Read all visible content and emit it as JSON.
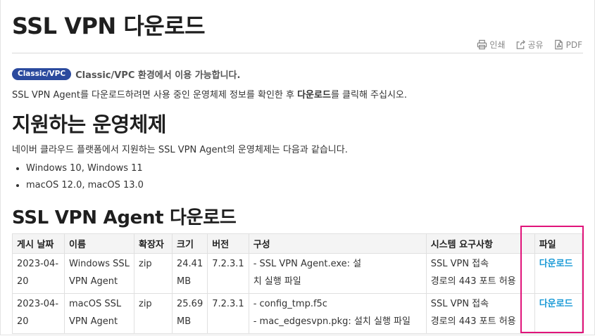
{
  "header": {
    "title": "SSL VPN 다운로드",
    "tools": {
      "print": "인쇄",
      "share": "공유",
      "pdf": "PDF"
    }
  },
  "env": {
    "badge": "Classic/VPC",
    "text": "Classic/VPC 환경에서 이용 가능합니다."
  },
  "intro": {
    "before": "SSL VPN Agent를 다운로드하려면 사용 중인 운영체제 정보를 확인한 후 ",
    "bold": "다운로드",
    "after": "를 클릭해 주십시오."
  },
  "os_section": {
    "heading": "지원하는 운영체제",
    "desc": "네이버 클라우드 플랫폼에서 지원하는 SSL VPN Agent의 운영체제는 다음과 같습니다.",
    "items": [
      "Windows 10, Windows 11",
      "macOS 12.0, macOS 13.0"
    ]
  },
  "download_section": {
    "heading": "SSL VPN Agent 다운로드",
    "columns": [
      "게시 날짜",
      "이름",
      "확장자",
      "크기",
      "버전",
      "구성",
      "시스템 요구사항",
      "파일"
    ],
    "rows": [
      {
        "date_a": "2023-04-",
        "date_b": "20",
        "name_a": "Windows SSL",
        "name_b": "VPN Agent",
        "ext": "zip",
        "size_a": "24.41",
        "size_b": "MB",
        "version": "7.2.3.1",
        "config_a": "- SSL VPN Agent.exe: 설",
        "config_b": "치 실행 파일",
        "req_a": "SSL VPN 접속",
        "req_b": "경로의 443 포트 허용",
        "file": "다운로드"
      },
      {
        "date_a": "2023-04-",
        "date_b": "20",
        "name_a": "macOS SSL",
        "name_b": "VPN Agent",
        "ext": "zip",
        "size_a": "25.69",
        "size_b": "MB",
        "version": "7.2.3.1",
        "config_a": "- config_tmp.f5c",
        "config_b": "- mac_edgesvpn.pkg: 설치 실행 파일",
        "req_a": "SSL VPN 접속",
        "req_b": "경로의 443 포트 허용",
        "file": "다운로드"
      }
    ]
  },
  "colors": {
    "badge": "#2b4a9e",
    "link": "#1a9ad6",
    "highlight": "#e0147a"
  }
}
